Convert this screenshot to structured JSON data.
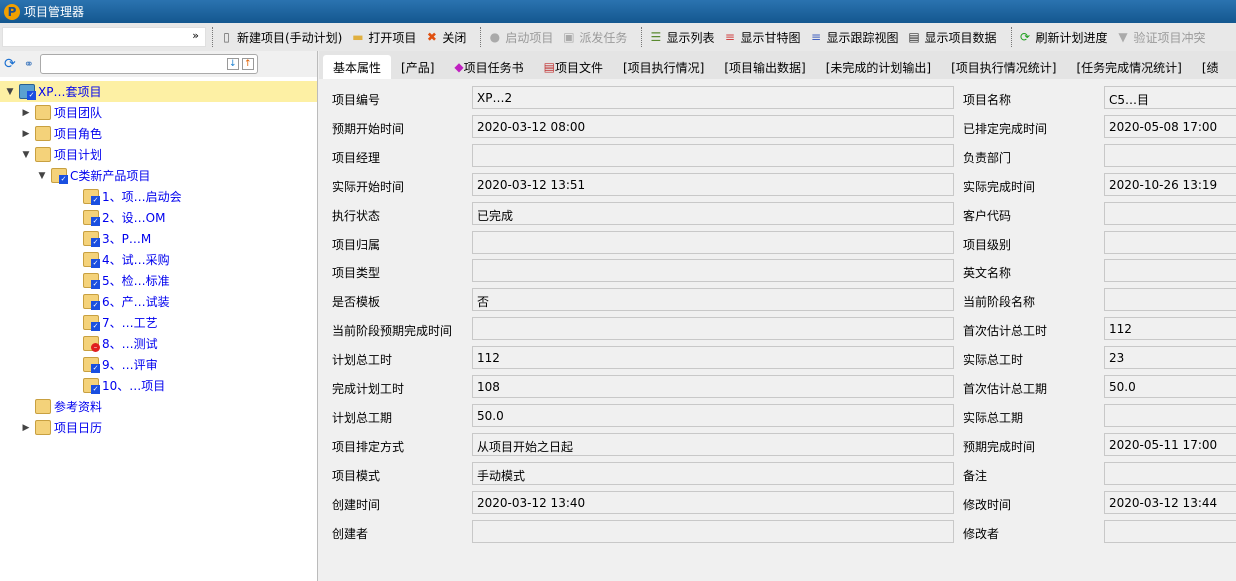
{
  "title": "项目管理器",
  "toolbar": {
    "combo_value": "",
    "buttons": [
      {
        "label": "新建项目(手动计划)",
        "icon": "new-document-icon",
        "enabled": true
      },
      {
        "label": "打开项目",
        "icon": "folder-open-icon",
        "enabled": true
      },
      {
        "label": "关闭",
        "icon": "close-icon",
        "enabled": true
      },
      {
        "label": "启动项目",
        "icon": "play-icon",
        "enabled": false
      },
      {
        "label": "派发任务",
        "icon": "dispatch-icon",
        "enabled": false
      },
      {
        "label": "显示列表",
        "icon": "list-icon",
        "enabled": true
      },
      {
        "label": "显示甘特图",
        "icon": "gantt-icon",
        "enabled": true
      },
      {
        "label": "显示跟踪视图",
        "icon": "tracking-icon",
        "enabled": true
      },
      {
        "label": "显示项目数据",
        "icon": "data-icon",
        "enabled": true
      },
      {
        "label": "刷新计划进度",
        "icon": "refresh-icon",
        "enabled": true
      },
      {
        "label": "验证项目冲突",
        "icon": "verify-icon",
        "enabled": false
      }
    ]
  },
  "tree": {
    "search_value": "",
    "nodes": [
      {
        "label": "XP…套项目",
        "level": 0,
        "expanded": true,
        "selected": true
      },
      {
        "label": "项目团队",
        "level": 1
      },
      {
        "label": "项目角色",
        "level": 1
      },
      {
        "label": "项目计划",
        "level": 1,
        "expanded": true
      },
      {
        "label": "C类新产品项目",
        "level": 2,
        "expanded": true
      },
      {
        "label": "1、项…启动会",
        "level": 3
      },
      {
        "label": "2、设…OM",
        "level": 3
      },
      {
        "label": "3、P…M",
        "level": 3
      },
      {
        "label": "4、试…采购",
        "level": 3
      },
      {
        "label": "5、检…标准",
        "level": 3
      },
      {
        "label": "6、产…试装",
        "level": 3
      },
      {
        "label": "7、…工艺",
        "level": 3
      },
      {
        "label": "8、…测试",
        "level": 3,
        "status": "error"
      },
      {
        "label": "9、…评审",
        "level": 3
      },
      {
        "label": "10、…项目",
        "level": 3
      },
      {
        "label": "参考资料",
        "level": 1
      },
      {
        "label": "项目日历",
        "level": 1
      }
    ]
  },
  "tabs": [
    "基本属性",
    "[产品]",
    "项目任务书",
    "项目文件",
    "[项目执行情况]",
    "[项目输出数据]",
    "[未完成的计划输出]",
    "[项目执行情况统计]",
    "[任务完成情况统计]",
    "[绩"
  ],
  "form": [
    {
      "l": "项目编号",
      "lv": "XP…2",
      "r": "项目名称",
      "rv": "C5…目"
    },
    {
      "l": "预期开始时间",
      "lv": "2020-03-12 08:00",
      "r": "已排定完成时间",
      "rv": "2020-05-08 17:00"
    },
    {
      "l": "项目经理",
      "lv": "",
      "r": "负责部门",
      "rv": ""
    },
    {
      "l": "实际开始时间",
      "lv": "2020-03-12 13:51",
      "r": "实际完成时间",
      "rv": "2020-10-26 13:19"
    },
    {
      "l": "执行状态",
      "lv": "已完成",
      "r": "客户代码",
      "rv": ""
    },
    {
      "l": "项目归属",
      "lv": "",
      "r": "项目级别",
      "rv": ""
    },
    {
      "l": "项目类型",
      "lv": "",
      "r": "英文名称",
      "rv": ""
    },
    {
      "l": "是否模板",
      "lv": "否",
      "r": "当前阶段名称",
      "rv": ""
    },
    {
      "l": "当前阶段预期完成时间",
      "lv": "",
      "r": "首次估计总工时",
      "rv": "112"
    },
    {
      "l": "计划总工时",
      "lv": "112",
      "r": "实际总工时",
      "rv": "23"
    },
    {
      "l": "完成计划工时",
      "lv": "108",
      "r": "首次估计总工期",
      "rv": "50.0"
    },
    {
      "l": "计划总工期",
      "lv": "50.0",
      "r": "实际总工期",
      "rv": ""
    },
    {
      "l": "项目排定方式",
      "lv": "从项目开始之日起",
      "r": "预期完成时间",
      "rv": "2020-05-11 17:00"
    },
    {
      "l": "项目模式",
      "lv": "手动模式",
      "r": "备注",
      "rv": ""
    },
    {
      "l": "创建时间",
      "lv": "2020-03-12 13:40",
      "r": "修改时间",
      "rv": "2020-03-12 13:44"
    },
    {
      "l": "创建者",
      "lv": "",
      "r": "修改者",
      "rv": ""
    }
  ]
}
